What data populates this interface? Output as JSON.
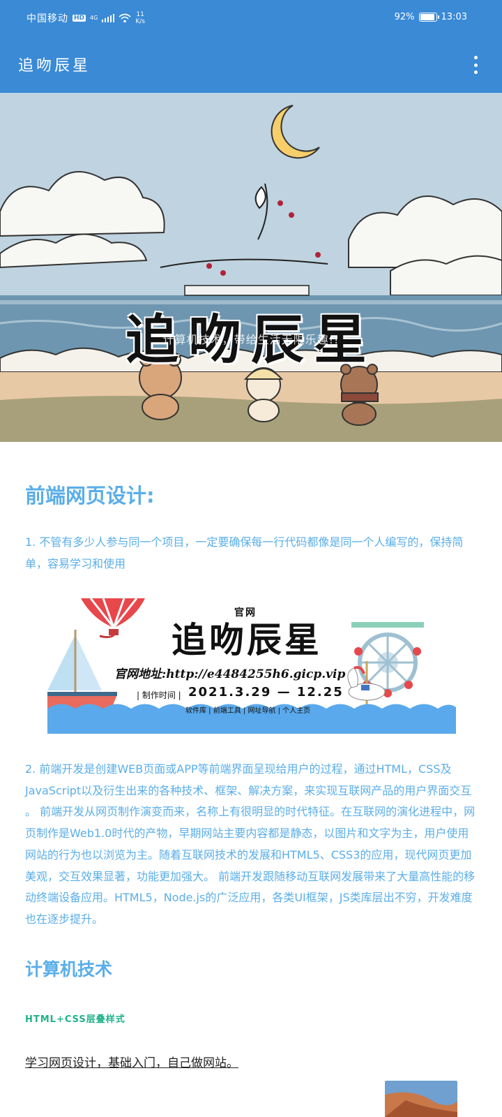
{
  "status_bar": {
    "carrier": "中国移动",
    "hd": "HD",
    "network": "4G",
    "speed_value": "11",
    "speed_unit": "K/s",
    "battery": "92%",
    "battery_level": 0.92,
    "time": "13:03"
  },
  "app_bar": {
    "title": "追吻辰星"
  },
  "hero": {
    "title": "追吻辰星",
    "subtitle": "计算机技术，带给生活无限乐趣!!"
  },
  "article": {
    "heading": "前端网页设计:",
    "para1": "1.  不管有多少人参与同一个项目，一定要确保每一行代码都像是同一个人编写的，保持简单，容易学习和使用",
    "para2": "2. 前端开发是创建WEB页面或APP等前端界面呈现给用户的过程，通过HTML，CSS及JavaScript以及衍生出来的各种技术、框架、解决方案，来实现互联网产品的用户界面交互 。 前端开发从网页制作演变而来，名称上有很明显的时代特征。在互联网的演化进程中，网页制作是Web1.0时代的产物，早期网站主要内容都是静态，以图片和文字为主，用户使用网站的行为也以浏览为主。随着互联网技术的发展和HTML5、CSS3的应用，现代网页更加美观，交互效果显著，功能更加强大。 前端开发跟随移动互联网发展带来了大量高性能的移动终端设备应用。HTML5，Node.js的广泛应用，各类UI框架，JS类库层出不穷，开发难度也在逐步提升。",
    "section_heading": "计算机技术",
    "sub_heading": "HTML+CSS层叠样式",
    "link": "学习网页设计，基础入门，自己做网站。"
  },
  "ad_banner": {
    "official": "官网",
    "title": "追吻辰星",
    "url": "官网地址:http://e4484255h6.gicp.vip",
    "date_label": "| 制作时间 |",
    "date": "2021.3.29 — 12.25",
    "links": "软件库 | 前端工具 | 网址导航 | 个人主页"
  },
  "colors": {
    "primary": "#3a8ad6",
    "text_blue": "#5aaee8",
    "accent_green": "#20b28a"
  }
}
